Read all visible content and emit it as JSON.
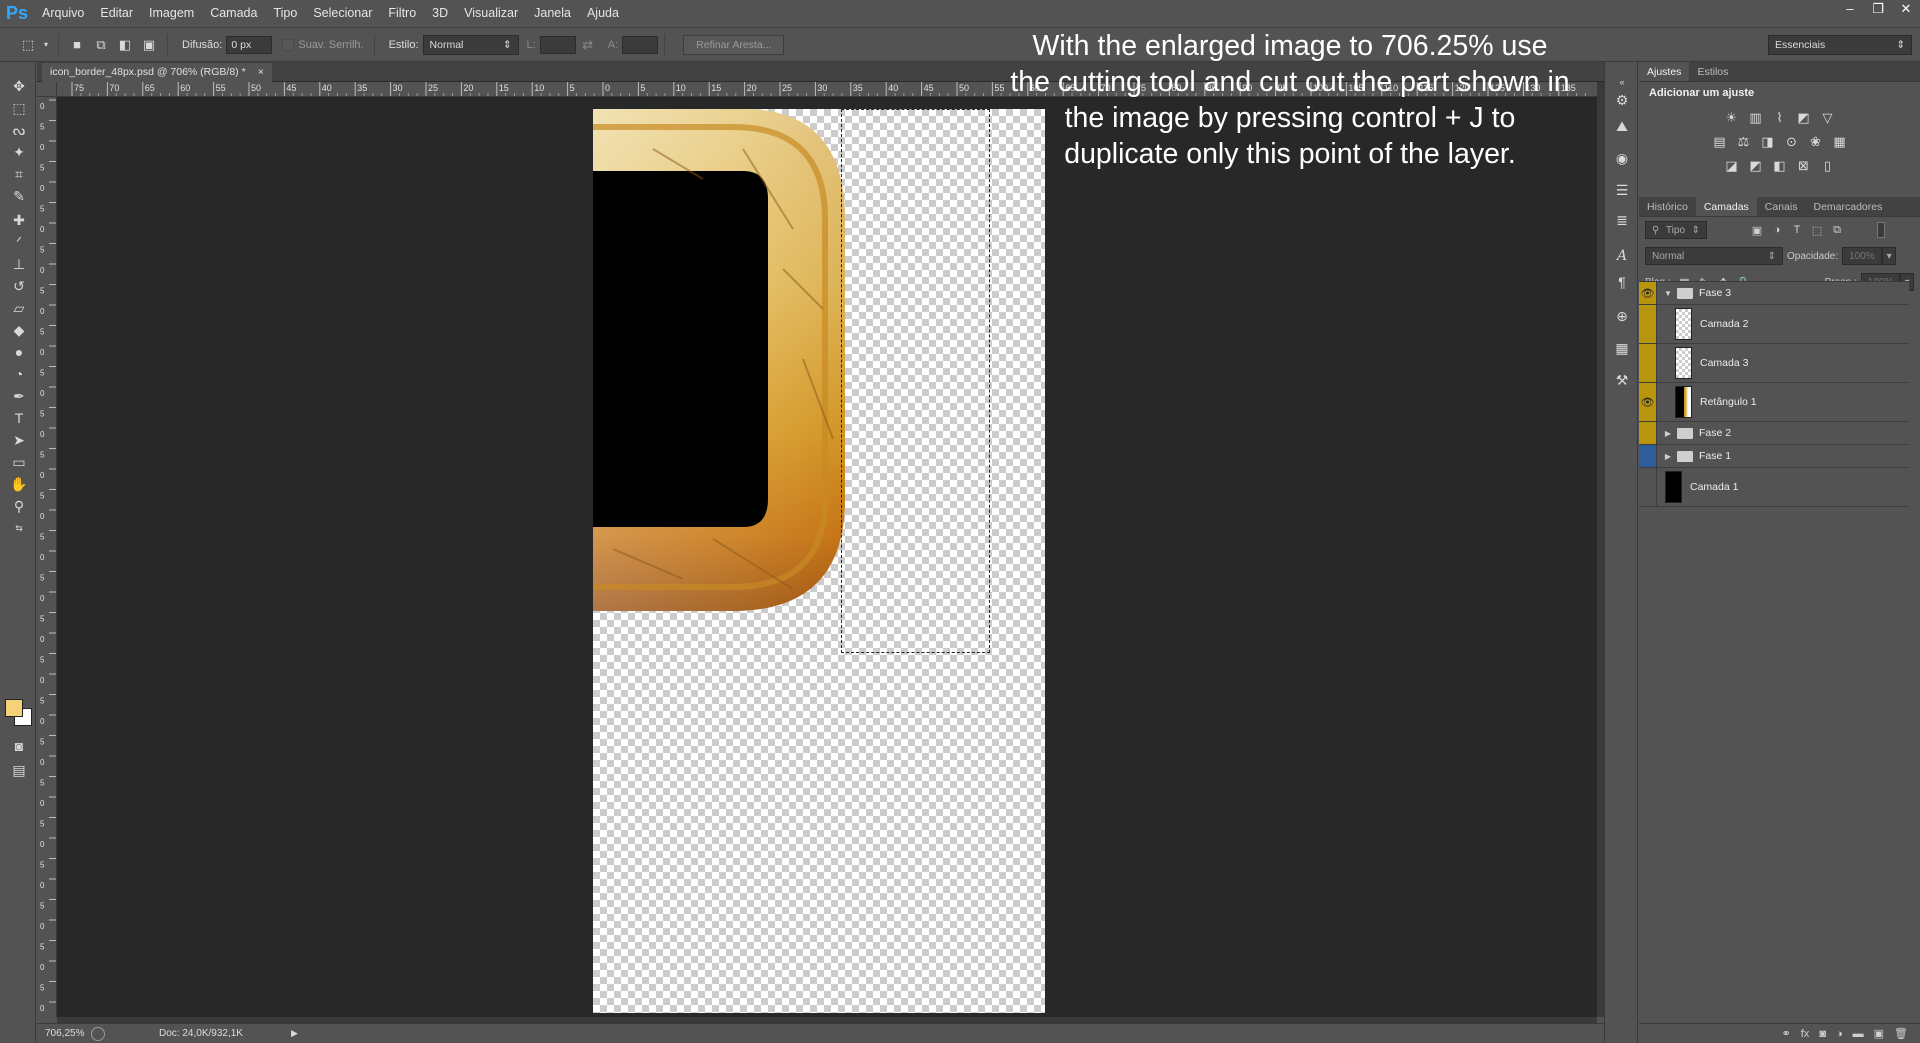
{
  "app": {
    "logo": "Ps"
  },
  "menu": [
    "Arquivo",
    "Editar",
    "Imagem",
    "Camada",
    "Tipo",
    "Selecionar",
    "Filtro",
    "3D",
    "Visualizar",
    "Janela",
    "Ajuda"
  ],
  "window_controls": {
    "minimize": "–",
    "restore": "❐",
    "close": "✕"
  },
  "options": {
    "feather_label": "Difusão:",
    "feather_value": "0 px",
    "antialias_label": "Suav. Serrilh.",
    "style_label": "Estilo:",
    "style_value": "Normal",
    "width_label": "L:",
    "height_label": "A:",
    "refine_button": "Refinar Aresta...",
    "workspace": "Essenciais"
  },
  "document": {
    "tab_title": "icon_border_48px.psd @ 706% (RGB/8) *",
    "tab_close": "×"
  },
  "rulers": {
    "horizontal": [
      "75",
      "70",
      "65",
      "60",
      "55",
      "50",
      "45",
      "40",
      "35",
      "30",
      "25",
      "20",
      "15",
      "10",
      "5",
      "0",
      "5",
      "10",
      "15",
      "20",
      "25",
      "30",
      "35",
      "40",
      "45",
      "50",
      "55",
      "60",
      "65",
      "70",
      "75",
      "80",
      "85",
      "90",
      "95",
      "100",
      "105",
      "110",
      "115",
      "120",
      "125",
      "130",
      "135"
    ],
    "vertical": [
      "0",
      "5",
      "0",
      "5",
      "0",
      "5",
      "0",
      "5",
      "0",
      "5",
      "0",
      "5",
      "0",
      "5",
      "0",
      "5",
      "0",
      "5",
      "0",
      "5",
      "0",
      "5",
      "0",
      "5",
      "0",
      "5",
      "0",
      "5",
      "0",
      "5",
      "0",
      "5",
      "0",
      "5",
      "0",
      "5",
      "0",
      "5",
      "0",
      "5",
      "0",
      "5",
      "0",
      "5",
      "0",
      "5"
    ]
  },
  "tutorial_text": "With the enlarged image to 706.25% use the cutting tool and cut out the part shown in the image by pressing control + J to duplicate only this point of the layer.",
  "status": {
    "zoom": "706,25%",
    "doc_info": "Doc: 24,0K/932,1K",
    "arrow": "▶"
  },
  "adjustments_panel": {
    "tabs": [
      "Ajustes",
      "Estilos"
    ],
    "title": "Adicionar um ajuste"
  },
  "layers_panel": {
    "tabs": [
      "Histórico",
      "Camadas",
      "Canais",
      "Demarcadores"
    ],
    "filter_value": "Tipo",
    "blend_mode": "Normal",
    "opacity_label": "Opacidade:",
    "opacity_value": "100%",
    "lock_label": "Bloq.:",
    "fill_label": "Preen.:",
    "fill_value": "100%",
    "layers": [
      {
        "name": "Fase 3"
      },
      {
        "name": "Camada 2"
      },
      {
        "name": "Camada 3"
      },
      {
        "name": "Retângulo 1"
      },
      {
        "name": "Fase 2"
      },
      {
        "name": "Fase 1"
      },
      {
        "name": "Camada 1"
      }
    ]
  },
  "colors": {
    "foreground": "#f3d27a",
    "background": "#ffffff",
    "selected_layer": "#b8940f",
    "accent_blue": "#2f5d9a"
  },
  "icons": {
    "toolbar": [
      "move-icon",
      "marquee-icon",
      "lasso-icon",
      "magic-wand-icon",
      "crop-icon",
      "eyedropper-icon",
      "healing-brush-icon",
      "brush-icon",
      "stamp-icon",
      "history-brush-icon",
      "eraser-icon",
      "paint-bucket-icon",
      "blur-icon",
      "dodge-icon",
      "pen-icon",
      "type-icon",
      "path-selection-icon",
      "rectangle-icon",
      "hand-icon",
      "zoom-icon"
    ]
  }
}
